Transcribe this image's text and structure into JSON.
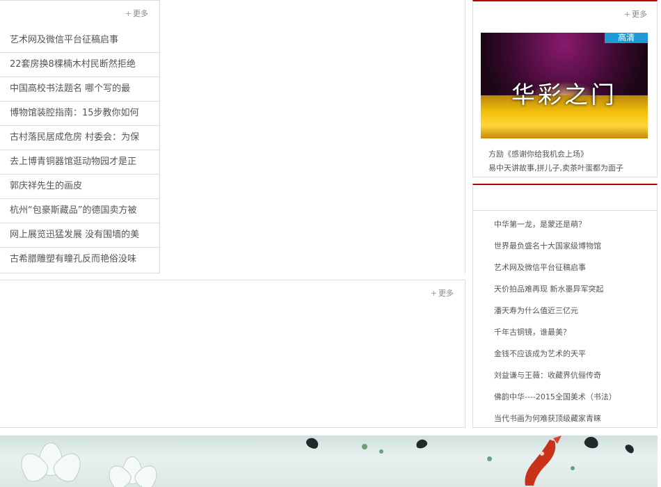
{
  "left_panel": {
    "more_plus": "+",
    "more_label": "更多",
    "items": [
      "艺术网及微信平台征稿启事",
      "22套房换8棵楠木村民断然拒绝",
      "中国高校书法题名 哪个写的最",
      "博物馆装腔指南：15步教你如何",
      "古村落民居成危房 村委会：为保",
      "去上博青铜器馆逛动物园才是正",
      "郭庆祥先生的画皮",
      "杭州“包豪斯藏品”的德国卖方被",
      "网上展览迅猛发展 没有围墙的美",
      "古希腊雕塑有瞳孔反而艳俗没味"
    ]
  },
  "bottom_middle_panel": {
    "more_plus": "+",
    "more_label": "更多"
  },
  "video_panel": {
    "more_plus": "+",
    "more_label": "更多",
    "badge": "高清",
    "thumb_title": "华彩之门",
    "captions": [
      "方励《感谢你给我机会上场》",
      "易中天讲故事,拼儿子,卖茶叶蛋都为面子"
    ]
  },
  "rank_panel": {
    "items": [
      "中华第一龙，是蒙还是萌？",
      "世界最负盛名十大国家级博物馆",
      "艺术网及微信平台征稿启事",
      "天价拍品难再现 新水墨异军突起",
      "潘天寿为什么值近三亿元",
      "千年古铜镜，谁最美？",
      "金钱不应该成为艺术的天平",
      "刘益谦与王薇：收藏界伉俪传奇",
      "佛韵中华----2015全国美术（书法）",
      "当代书画为何难获顶级藏家青睐"
    ]
  },
  "colors": {
    "accent_red": "#b80000",
    "badge_blue": "#1e9bd7",
    "border": "#dddddd"
  },
  "icons": {
    "banner": "lotus-koi-banner"
  }
}
